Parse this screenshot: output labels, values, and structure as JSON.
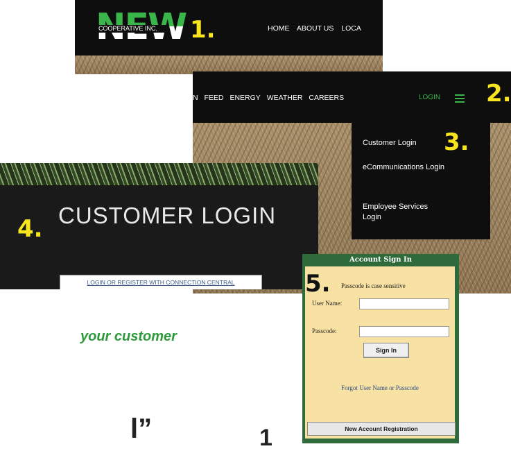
{
  "steps": {
    "s1": "1.",
    "s2": "2.",
    "s3": "3.",
    "s4": "4.",
    "s5": "5."
  },
  "site_header": {
    "logo_text": "NEW",
    "logo_subtext": "COOPERATIVE INC.",
    "nav_items": [
      "HOME",
      "ABOUT US",
      "LOCA"
    ]
  },
  "nav_bar": {
    "items": [
      "N",
      "FEED",
      "ENERGY",
      "WEATHER",
      "CAREERS"
    ],
    "login_label": "LOGIN",
    "menu_icon": "hamburger-icon"
  },
  "login_menu": {
    "items": [
      "Customer Login",
      "eCommunications Login",
      "Employee Services Login"
    ]
  },
  "customer_login": {
    "title": "CUSTOMER LOGIN",
    "button_label": "LOGIN OR REGISTER WITH CONNECTION CENTRAL"
  },
  "sign_in": {
    "header": "Account Sign In",
    "note": "Passcode is case sensitive",
    "user_label": "User Name:",
    "pass_label": "Passcode:",
    "user_value": "",
    "pass_value": "",
    "sign_in_label": "Sign In",
    "forgot_label": "Forgot User Name or Passcode",
    "register_label": "New Account Registration"
  },
  "page_text": {
    "subtitle_fragment": "your customer",
    "quote_fragment": "l”",
    "number_fragment": "1"
  },
  "colors": {
    "brand_green": "#3ab54a",
    "step_yellow": "#f7e51d",
    "signin_frame": "#2f6b3a",
    "signin_bg": "#f8e2a3"
  }
}
